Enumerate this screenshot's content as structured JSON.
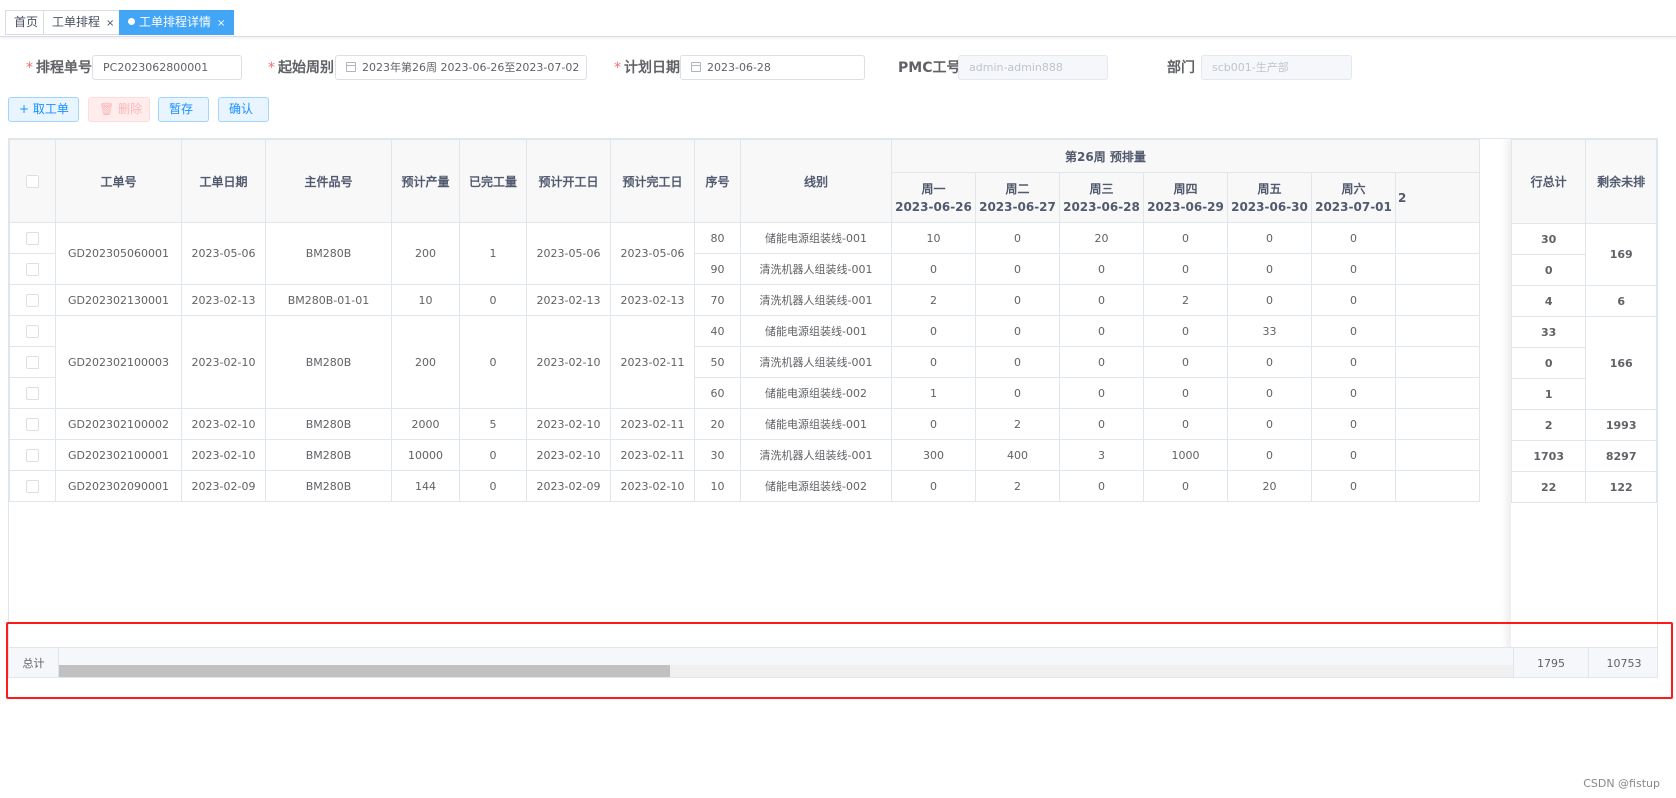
{
  "tabs": [
    {
      "label": "首页",
      "closable": false,
      "active": false
    },
    {
      "label": "工单排程",
      "closable": true,
      "active": false
    },
    {
      "label": "工单排程详情",
      "closable": true,
      "active": true
    }
  ],
  "form": {
    "schedule_no": {
      "label": "排程单号",
      "required": true,
      "value": "PC2023062800001"
    },
    "start_week": {
      "label": "起始周别",
      "required": true,
      "value": "2023年第26周 2023-06-26至2023-07-02"
    },
    "plan_date": {
      "label": "计划日期",
      "required": true,
      "value": "2023-06-28"
    },
    "pmc": {
      "label": "PMC工号",
      "required": false,
      "value": "admin-admin888"
    },
    "dept": {
      "label": "部门",
      "required": false,
      "value": "scb001-生产部"
    }
  },
  "toolbar": {
    "take_order": "+ 取工单",
    "delete": "删除",
    "save_draft": "暂存",
    "confirm": "确认"
  },
  "table": {
    "headers": {
      "order_no": "工单号",
      "order_date": "工单日期",
      "item_no": "主件品号",
      "planned_qty": "预计产量",
      "done_qty": "已完工量",
      "start_date": "预计开工日",
      "end_date": "预计完工日",
      "seq": "序号",
      "line": "线别",
      "week_group": "第26周 预排量",
      "row_total": "行总计",
      "remaining": "剩余未排"
    },
    "days": [
      {
        "weekday": "周一",
        "date": "2023-06-26"
      },
      {
        "weekday": "周二",
        "date": "2023-06-27"
      },
      {
        "weekday": "周三",
        "date": "2023-06-28"
      },
      {
        "weekday": "周四",
        "date": "2023-06-29"
      },
      {
        "weekday": "周五",
        "date": "2023-06-30"
      },
      {
        "weekday": "周六",
        "date": "2023-07-01"
      },
      {
        "weekday": "",
        "date": "2"
      }
    ],
    "groups": [
      {
        "order_no": "GD202305060001",
        "order_date": "2023-05-06",
        "item_no": "BM280B",
        "planned_qty": "200",
        "done_qty": "1",
        "start_date": "2023-05-06",
        "end_date": "2023-05-06",
        "remaining": "169",
        "lines": [
          {
            "seq": "80",
            "line": "储能电源组装线-001",
            "days": [
              "10",
              "0",
              "20",
              "0",
              "0",
              "0"
            ],
            "total": "30"
          },
          {
            "seq": "90",
            "line": "清洗机器人组装线-001",
            "days": [
              "0",
              "0",
              "0",
              "0",
              "0",
              "0"
            ],
            "total": "0"
          }
        ]
      },
      {
        "order_no": "GD202302130001",
        "order_date": "2023-02-13",
        "item_no": "BM280B-01-01",
        "planned_qty": "10",
        "done_qty": "0",
        "start_date": "2023-02-13",
        "end_date": "2023-02-13",
        "remaining": "6",
        "lines": [
          {
            "seq": "70",
            "line": "清洗机器人组装线-001",
            "days": [
              "2",
              "0",
              "0",
              "2",
              "0",
              "0"
            ],
            "total": "4"
          }
        ]
      },
      {
        "order_no": "GD202302100003",
        "order_date": "2023-02-10",
        "item_no": "BM280B",
        "planned_qty": "200",
        "done_qty": "0",
        "start_date": "2023-02-10",
        "end_date": "2023-02-11",
        "remaining": "166",
        "lines": [
          {
            "seq": "40",
            "line": "储能电源组装线-001",
            "days": [
              "0",
              "0",
              "0",
              "0",
              "33",
              "0"
            ],
            "total": "33"
          },
          {
            "seq": "50",
            "line": "清洗机器人组装线-001",
            "days": [
              "0",
              "0",
              "0",
              "0",
              "0",
              "0"
            ],
            "total": "0"
          },
          {
            "seq": "60",
            "line": "储能电源组装线-002",
            "days": [
              "1",
              "0",
              "0",
              "0",
              "0",
              "0"
            ],
            "total": "1"
          }
        ]
      },
      {
        "order_no": "GD202302100002",
        "order_date": "2023-02-10",
        "item_no": "BM280B",
        "planned_qty": "2000",
        "done_qty": "5",
        "start_date": "2023-02-10",
        "end_date": "2023-02-11",
        "remaining": "1993",
        "lines": [
          {
            "seq": "20",
            "line": "储能电源组装线-001",
            "days": [
              "0",
              "2",
              "0",
              "0",
              "0",
              "0"
            ],
            "total": "2"
          }
        ]
      },
      {
        "order_no": "GD202302100001",
        "order_date": "2023-02-10",
        "item_no": "BM280B",
        "planned_qty": "10000",
        "done_qty": "0",
        "start_date": "2023-02-10",
        "end_date": "2023-02-11",
        "remaining": "8297",
        "lines": [
          {
            "seq": "30",
            "line": "清洗机器人组装线-001",
            "days": [
              "300",
              "400",
              "3",
              "1000",
              "0",
              "0"
            ],
            "total": "1703"
          }
        ]
      },
      {
        "order_no": "GD202302090001",
        "order_date": "2023-02-09",
        "item_no": "BM280B",
        "planned_qty": "144",
        "done_qty": "0",
        "start_date": "2023-02-09",
        "end_date": "2023-02-10",
        "remaining": "122",
        "lines": [
          {
            "seq": "10",
            "line": "储能电源组装线-002",
            "days": [
              "0",
              "2",
              "0",
              "0",
              "20",
              "0"
            ],
            "total": "22"
          }
        ]
      }
    ],
    "summary": {
      "label": "总计",
      "row_total": "1795",
      "remaining": "10753"
    },
    "scrollbar": {
      "position": 0.42
    }
  },
  "watermark": "CSDN @fistup",
  "colors": {
    "primary": "#1890ff",
    "active_tab": "#42a5f5",
    "highlight": "#ff0000"
  }
}
